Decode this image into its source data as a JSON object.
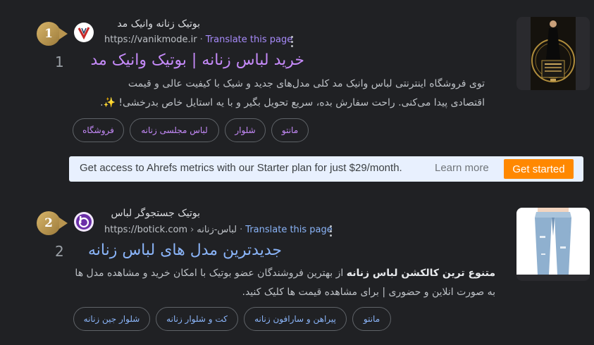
{
  "results": [
    {
      "rank": "1",
      "site_name": "بوتیک زنانه وانیک مد",
      "url": "https://vanikmode.ir",
      "url_path": "",
      "translate": "Translate this page",
      "index": "1",
      "title": "خرید لباس زنانه | بوتیک وانیک مد",
      "snippet_line1": "توی فروشگاه اینترنتی لباس وانیک مد کلی مدل‌های جدید و شیک با کیفیت عالی و قیمت",
      "snippet_line2": "اقتصادی پیدا می‌کنی. راحت سفارش بده، سریع تحویل بگیر و با یه استایل خاص بدرخشی! ✨.",
      "chips": [
        "مانتو",
        "شلوار",
        "لباس مجلسی زنانه",
        "فروشگاه"
      ],
      "favicon_letter": "V"
    },
    {
      "rank": "2",
      "site_name": "بوتیک جستجوگر لباس",
      "url": "https://botick.com",
      "url_path": "لباس-زنانه",
      "translate": "Translate this page",
      "index": "2",
      "title": "جدیدترین مدل های لباس زنانه",
      "snippet_bold": "متنوع ترین کالکشن لباس زنانه",
      "snippet_rest": " از بهترین فروشندگان عضو بوتیک با امکان خرید و مشاهده مدل ها",
      "snippet_line2": "به صورت انلاین و حضوری | برای مشاهده قیمت ها کلیک کنید.",
      "chips": [
        "مانتو",
        "پیراهن و سارافون زنانه",
        "کت و شلوار زنانه",
        "شلوار جین زنانه"
      ],
      "favicon_letter": "b"
    }
  ],
  "ahrefs": {
    "message": "Get access to Ahrefs metrics with our Starter plan for just $29/month.",
    "learn_more": "Learn more",
    "get_started": "Get started"
  },
  "colors": {
    "background": "#202124",
    "visited_title": "#c58af9",
    "link_title": "#8ab4f8",
    "badge_gold": "#c9a55c",
    "ahrefs_button": "#ff8800"
  }
}
